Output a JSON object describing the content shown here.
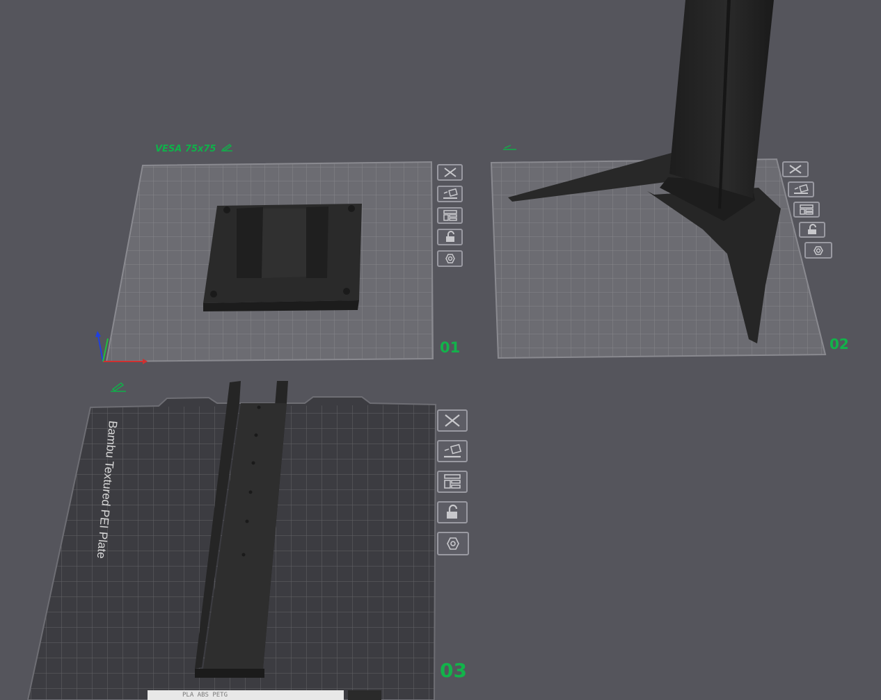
{
  "plates": [
    {
      "id": "plate-1",
      "name": "VESA 75x75",
      "number": "01"
    },
    {
      "id": "plate-2",
      "name": "",
      "number": "02"
    },
    {
      "id": "plate-3",
      "name": "",
      "number": "03",
      "bed_label": "Bambu Textured PEI Plate",
      "footer_text": "PLA ABS PETG"
    }
  ],
  "plate_toolbar_icons": [
    "close-icon",
    "auto-arrange-icon",
    "layout-icon",
    "lock-icon",
    "settings-icon"
  ],
  "colors": {
    "background": "#55555c",
    "plate_grid": "#8f8f95",
    "accent_green": "#12b34a",
    "model": "#2b2b2b",
    "pei_plate": "#3a3a3f"
  }
}
